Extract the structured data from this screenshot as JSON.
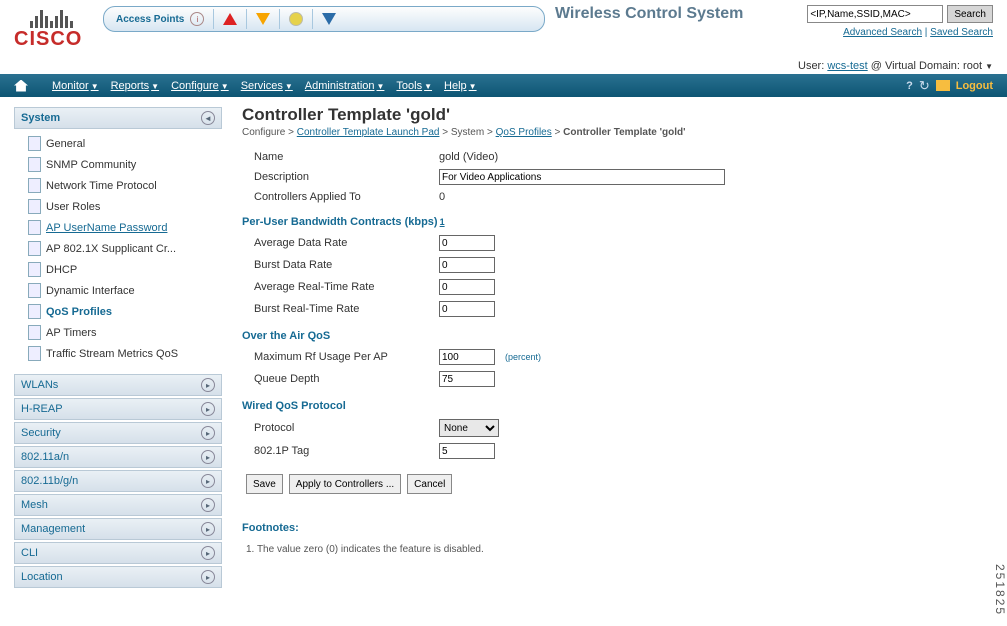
{
  "ap_label": "Access Points",
  "wcs": "Wireless Control System",
  "search_ph": "<IP,Name,SSID,MAC>",
  "search_btn": "Search",
  "adv_search": "Advanced Search",
  "saved_search": "Saved Search",
  "user_label": "User:",
  "user": "wcs-test",
  "vdom_label": "@ Virtual Domain:",
  "vdom": "root",
  "menu": [
    "Monitor",
    "Reports",
    "Configure",
    "Services",
    "Administration",
    "Tools",
    "Help"
  ],
  "logout": "Logout",
  "sb": {
    "system": "System",
    "items": [
      "General",
      "SNMP Community",
      "Network Time Protocol",
      "User Roles",
      "AP UserName Password",
      "AP 802.1X Supplicant Cr...",
      "DHCP",
      "Dynamic Interface",
      "QoS Profiles",
      "AP Timers",
      "Traffic Stream Metrics QoS"
    ],
    "groups": [
      "WLANs",
      "H-REAP",
      "Security",
      "802.11a/n",
      "802.11b/g/n",
      "Mesh",
      "Management",
      "CLI",
      "Location"
    ]
  },
  "title": "Controller Template 'gold'",
  "bc": {
    "c": "Configure",
    "l": "Controller Template Launch Pad",
    "s": "System",
    "q": "QoS Profiles",
    "cur": "Controller Template 'gold'"
  },
  "form": {
    "name_l": "Name",
    "name_v": "gold (Video)",
    "desc_l": "Description",
    "desc_v": "For Video Applications",
    "cap_l": "Controllers Applied To",
    "cap_v": "0",
    "s1": "Per-User Bandwidth Contracts (kbps)",
    "fn": "1",
    "adr_l": "Average Data Rate",
    "adr": "0",
    "bdr_l": "Burst Data Rate",
    "bdr": "0",
    "art_l": "Average Real-Time Rate",
    "art": "0",
    "brt_l": "Burst Real-Time Rate",
    "brt": "0",
    "s2": "Over the Air QoS",
    "rf_l": "Maximum Rf Usage Per AP",
    "rf": "100",
    "pct": "(percent)",
    "qd_l": "Queue Depth",
    "qd": "75",
    "s3": "Wired QoS Protocol",
    "proto_l": "Protocol",
    "proto": "None",
    "tag_l": "802.1P Tag",
    "tag": "5",
    "b_save": "Save",
    "b_apply": "Apply to Controllers ...",
    "b_cancel": "Cancel",
    "footn": "Footnotes:",
    "foot1": "1. The value zero (0) indicates the feature is disabled."
  },
  "side_id": "251825"
}
